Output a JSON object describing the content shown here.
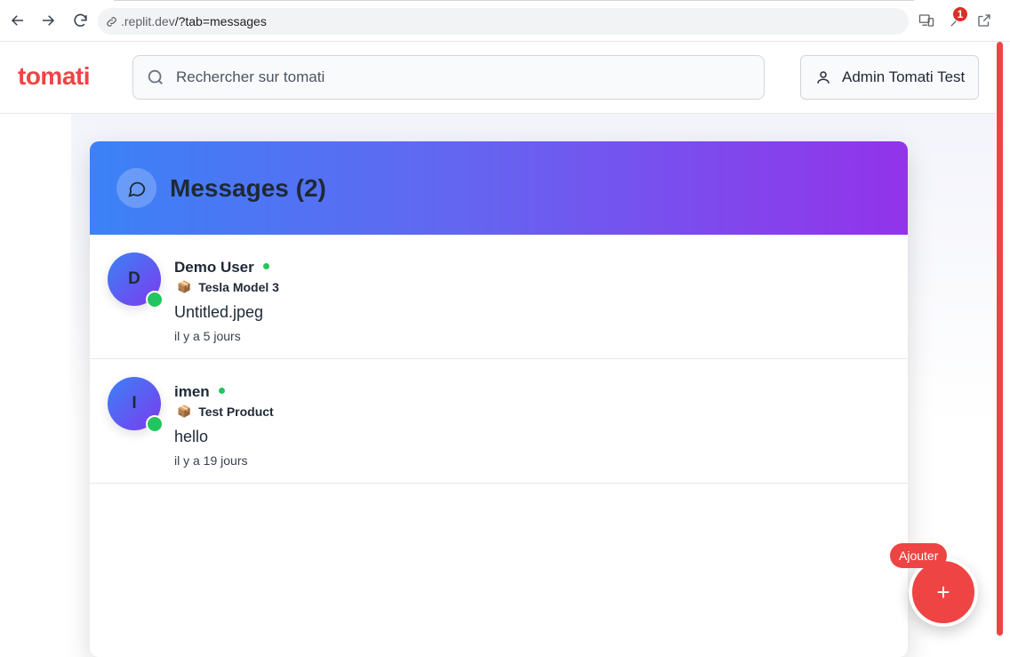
{
  "browser": {
    "url_domain": ".replit.dev",
    "url_path": "/?tab=messages",
    "extension_badge": "1"
  },
  "header": {
    "logo": "tomati",
    "search_placeholder": "Rechercher sur tomati",
    "user_label": "Admin Tomati Test"
  },
  "messages": {
    "title": "Messages (2)",
    "conversations": [
      {
        "initial": "D",
        "name": "Demo User",
        "product": "Tesla Model 3",
        "last_message": "Untitled.jpeg",
        "time": "il y a 5 jours"
      },
      {
        "initial": "I",
        "name": "imen",
        "product": "Test Product",
        "last_message": "hello",
        "time": "il y a 19 jours"
      }
    ]
  },
  "fab": {
    "tooltip": "Ajouter",
    "icon": "+"
  },
  "colors": {
    "brand": "#ef4444",
    "online": "#22c55e",
    "header_gradient_start": "#3b82f6",
    "header_gradient_end": "#9333ea"
  }
}
